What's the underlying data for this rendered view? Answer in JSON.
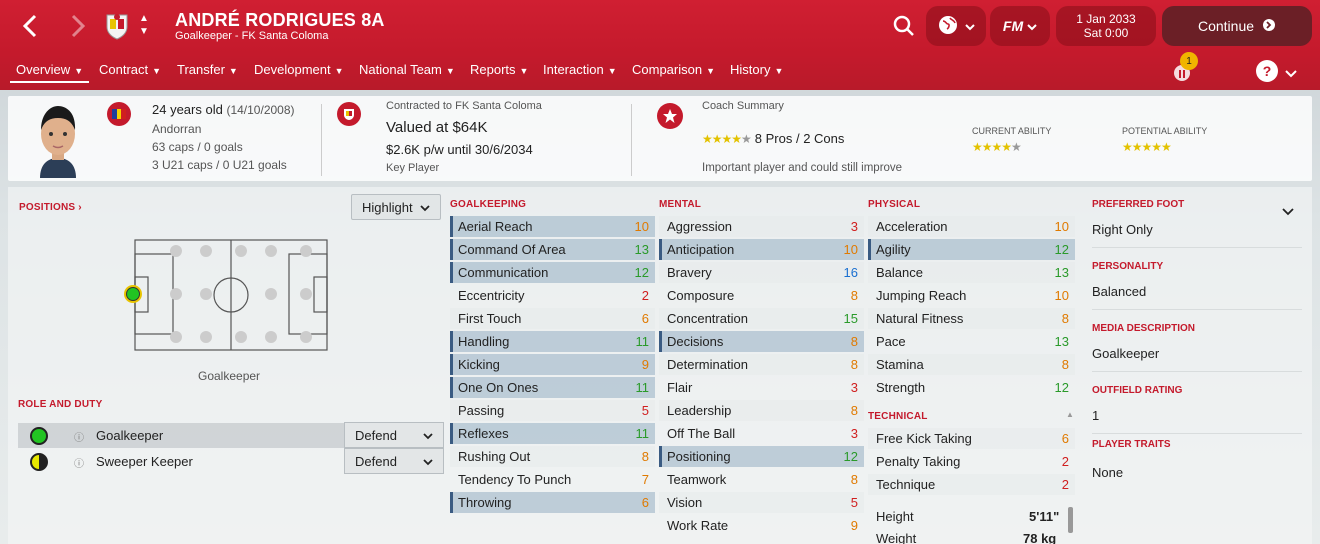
{
  "header": {
    "player_name": "ANDRÉ RODRIGUES 8A",
    "subtitle": "Goalkeeper - FK Santa Coloma",
    "date": "1 Jan 2033",
    "time": "Sat 0:00",
    "continue_label": "Continue",
    "fm_label": "FM",
    "notification_count": "1"
  },
  "tabs": [
    {
      "label": "Overview"
    },
    {
      "label": "Contract"
    },
    {
      "label": "Transfer"
    },
    {
      "label": "Development"
    },
    {
      "label": "National Team"
    },
    {
      "label": "Reports"
    },
    {
      "label": "Interaction"
    },
    {
      "label": "Comparison"
    },
    {
      "label": "History"
    }
  ],
  "summary": {
    "age": "24 years old",
    "dob": "(14/10/2008)",
    "nationality": "Andorran",
    "caps": "63 caps / 0 goals",
    "u21": "3 U21 caps / 0 U21 goals",
    "contract_label": "Contracted to FK Santa Coloma",
    "value": "Valued at $64K",
    "wage": "$2.6K p/w until 30/6/2034",
    "status": "Key Player",
    "coach_label": "Coach Summary",
    "pros_cons": "8 Pros / 2 Cons",
    "coach_note": "Important player and could still improve",
    "ca_label": "CURRENT ABILITY",
    "pa_label": "POTENTIAL ABILITY",
    "coach_stars": 4,
    "ca_stars": 4,
    "pa_stars": 5
  },
  "positions": {
    "header": "POSITIONS",
    "position_label": "Goalkeeper",
    "highlight": "Highlight"
  },
  "roles": {
    "header": "ROLE AND DUTY",
    "items": [
      {
        "name": "Goalkeeper",
        "duty": "Defend"
      },
      {
        "name": "Sweeper Keeper",
        "duty": "Defend"
      }
    ]
  },
  "goalkeeping": {
    "header": "GOALKEEPING",
    "items": [
      {
        "name": "Aerial Reach",
        "value": "10"
      },
      {
        "name": "Command Of Area",
        "value": "13"
      },
      {
        "name": "Communication",
        "value": "12"
      },
      {
        "name": "Eccentricity",
        "value": "2"
      },
      {
        "name": "First Touch",
        "value": "6"
      },
      {
        "name": "Handling",
        "value": "11"
      },
      {
        "name": "Kicking",
        "value": "9"
      },
      {
        "name": "One On Ones",
        "value": "11"
      },
      {
        "name": "Passing",
        "value": "5"
      },
      {
        "name": "Reflexes",
        "value": "11"
      },
      {
        "name": "Rushing Out",
        "value": "8"
      },
      {
        "name": "Tendency To Punch",
        "value": "7"
      },
      {
        "name": "Throwing",
        "value": "6"
      }
    ]
  },
  "mental": {
    "header": "MENTAL",
    "items": [
      {
        "name": "Aggression",
        "value": "3"
      },
      {
        "name": "Anticipation",
        "value": "10"
      },
      {
        "name": "Bravery",
        "value": "16"
      },
      {
        "name": "Composure",
        "value": "8"
      },
      {
        "name": "Concentration",
        "value": "15"
      },
      {
        "name": "Decisions",
        "value": "8"
      },
      {
        "name": "Determination",
        "value": "8"
      },
      {
        "name": "Flair",
        "value": "3"
      },
      {
        "name": "Leadership",
        "value": "8"
      },
      {
        "name": "Off The Ball",
        "value": "3"
      },
      {
        "name": "Positioning",
        "value": "12"
      },
      {
        "name": "Teamwork",
        "value": "8"
      },
      {
        "name": "Vision",
        "value": "5"
      },
      {
        "name": "Work Rate",
        "value": "9"
      }
    ]
  },
  "physical": {
    "header": "PHYSICAL",
    "items": [
      {
        "name": "Acceleration",
        "value": "10"
      },
      {
        "name": "Agility",
        "value": "12"
      },
      {
        "name": "Balance",
        "value": "13"
      },
      {
        "name": "Jumping Reach",
        "value": "10"
      },
      {
        "name": "Natural Fitness",
        "value": "8"
      },
      {
        "name": "Pace",
        "value": "13"
      },
      {
        "name": "Stamina",
        "value": "8"
      },
      {
        "name": "Strength",
        "value": "12"
      }
    ]
  },
  "technical": {
    "header": "TECHNICAL",
    "items": [
      {
        "name": "Free Kick Taking",
        "value": "6"
      },
      {
        "name": "Penalty Taking",
        "value": "2"
      },
      {
        "name": "Technique",
        "value": "2"
      }
    ]
  },
  "bio": {
    "height_label": "Height",
    "height": "5'11\"",
    "weight_label": "Weight",
    "weight": "78 kg"
  },
  "right": {
    "foot_h": "PREFERRED FOOT",
    "foot": "Right Only",
    "pers_h": "PERSONALITY",
    "pers": "Balanced",
    "media_h": "MEDIA DESCRIPTION",
    "media": "Goalkeeper",
    "outfield_h": "OUTFIELD RATING",
    "outfield": "1",
    "traits_h": "PLAYER TRAITS",
    "traits": "None"
  },
  "colors": {
    "header_red": "#c41a2c",
    "highlight_blue": "#3a5b82",
    "value_red": "#d01f1f",
    "value_orange": "#e07a00",
    "value_green": "#2a9a2a",
    "value_blue": "#1a6fd0"
  }
}
